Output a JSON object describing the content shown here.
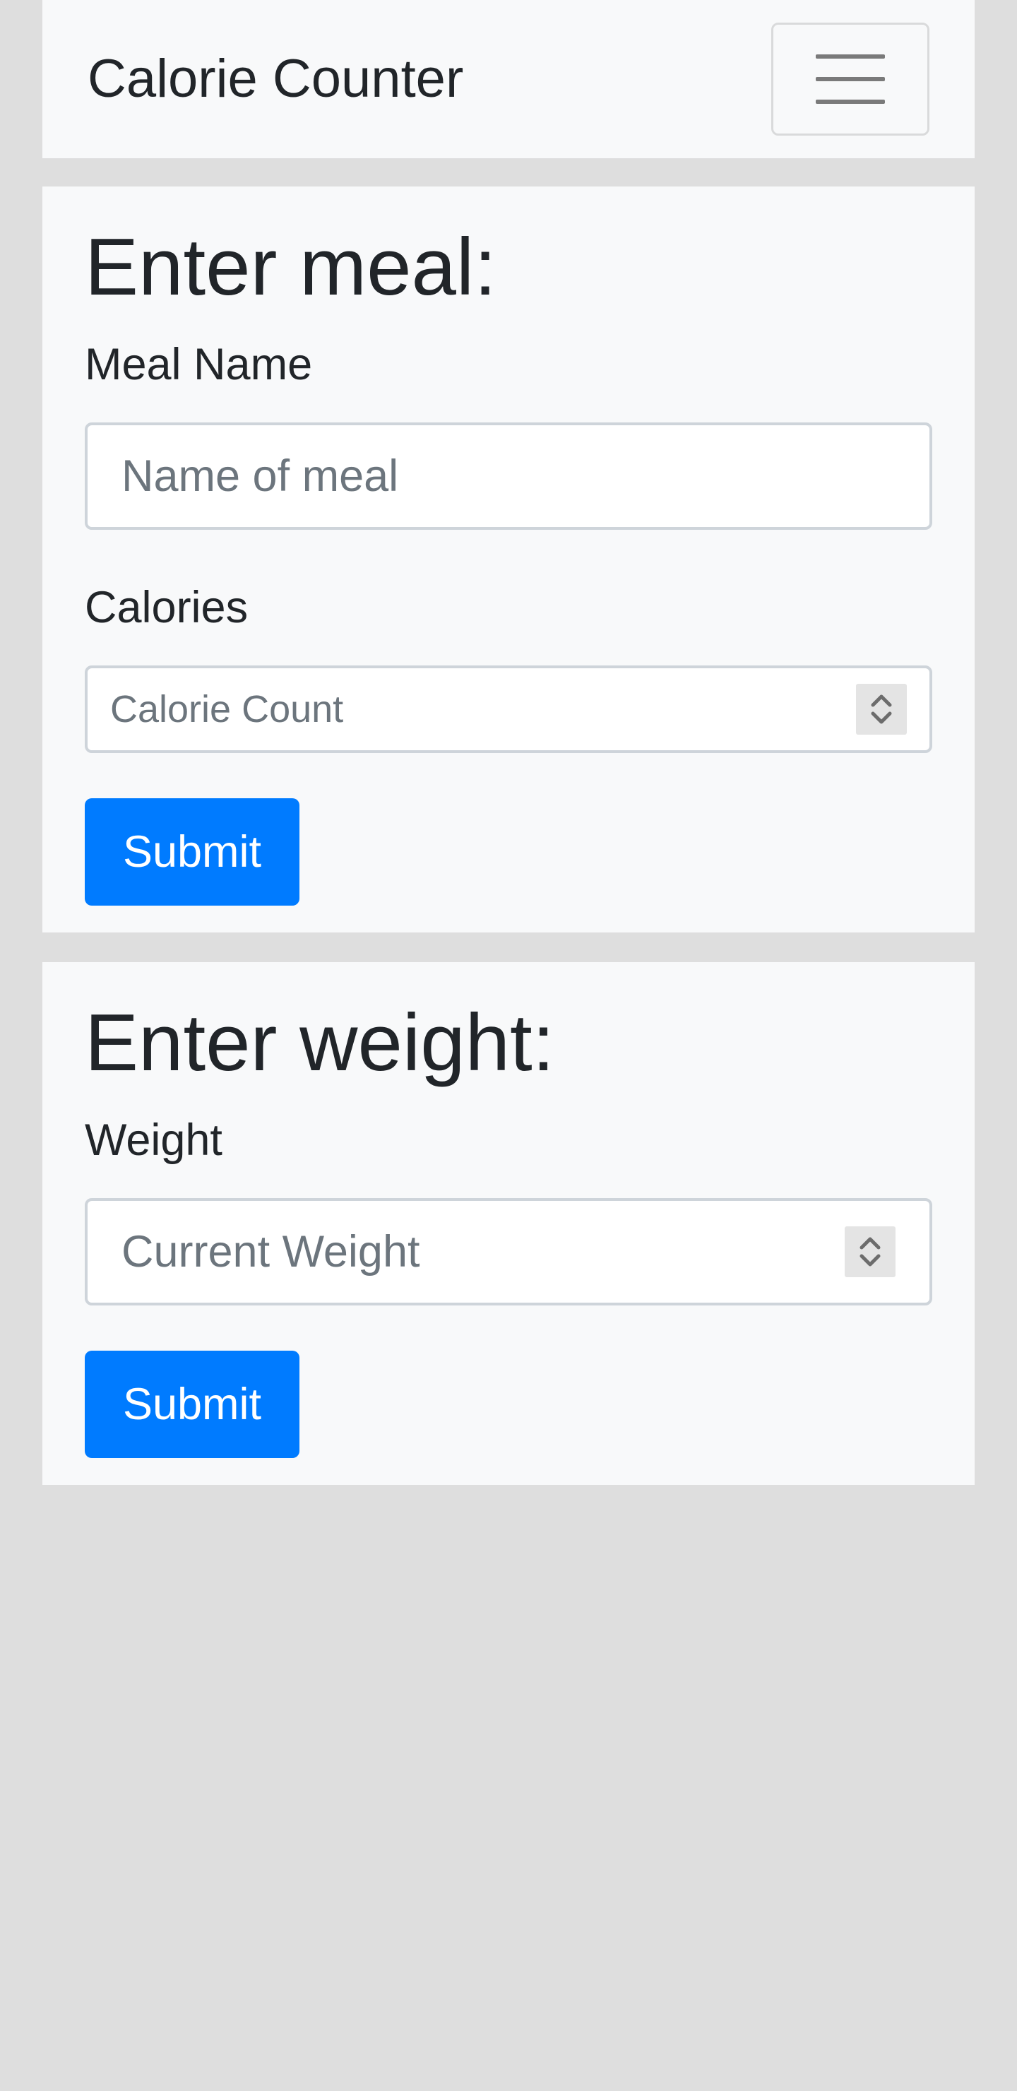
{
  "navbar": {
    "brand": "Calorie Counter",
    "toggler_icon": "hamburger-menu-icon"
  },
  "meal_form": {
    "heading": "Enter meal:",
    "meal_name_label": "Meal Name",
    "meal_name_placeholder": "Name of meal",
    "calories_label": "Calories",
    "calories_placeholder": "Calorie Count",
    "submit_label": "Submit"
  },
  "weight_form": {
    "heading": "Enter weight:",
    "weight_label": "Weight",
    "weight_placeholder": "Current Weight",
    "submit_label": "Submit"
  },
  "colors": {
    "page_background": "#dedede",
    "panel_background": "#f8f9fa",
    "primary_button": "#007bff",
    "input_border": "#ced4da",
    "placeholder_text": "#6c757d"
  }
}
